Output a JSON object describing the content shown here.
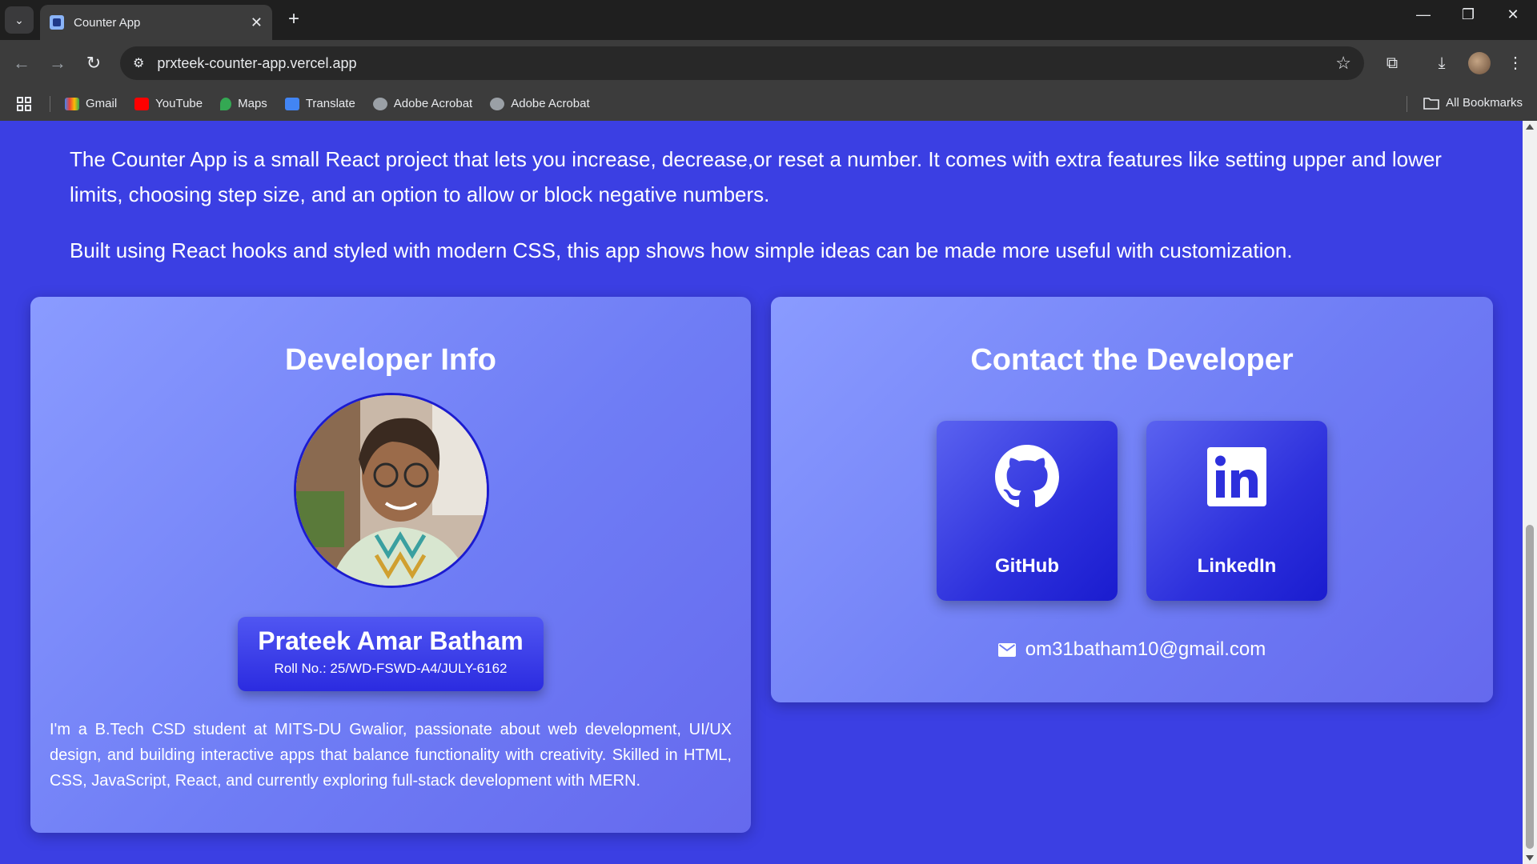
{
  "browser": {
    "tab_title": "Counter App",
    "tab_close": "✕",
    "new_tab": "+",
    "url": "prxteek-counter-app.vercel.app",
    "bookmarks": [
      "Gmail",
      "YouTube",
      "Maps",
      "Translate",
      "Adobe Acrobat",
      "Adobe Acrobat"
    ],
    "all_bookmarks": "All Bookmarks"
  },
  "about": {
    "p1": "The Counter App is a small React project that lets you increase, decrease,or reset a number. It comes with extra features like setting upper and lower limits, choosing step size, and an option to allow or block negative numbers.",
    "p2": "Built using React hooks and styled with modern CSS, this app shows how simple ideas can be made more useful with customization."
  },
  "developer": {
    "heading": "Developer Info",
    "name": "Prateek Amar Batham",
    "roll": "Roll No.: 25/WD-FSWD-A4/JULY-6162",
    "bio": "I'm a B.Tech CSD student at MITS-DU Gwalior, passionate about web development, UI/UX design, and building interactive apps that balance functionality with creativity. Skilled in HTML, CSS, JavaScript, React, and currently exploring full-stack development with MERN."
  },
  "contact": {
    "heading": "Contact the Developer",
    "github_label": "GitHub",
    "linkedin_label": "LinkedIn",
    "email": "om31batham10@gmail.com"
  },
  "colors": {
    "page_bg": "#3b3fe3",
    "card_gradient_start": "#8a9bff",
    "button_blue": "#2b2be0"
  }
}
